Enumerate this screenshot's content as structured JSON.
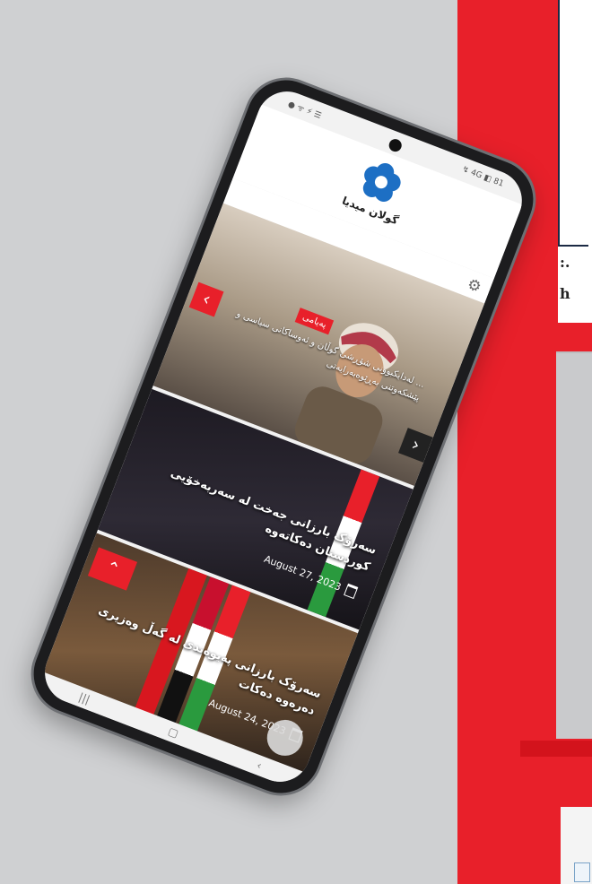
{
  "background": {
    "accent_red": "#e8202a",
    "side_text_1": ":.",
    "side_text_2": "h"
  },
  "status_bar": {
    "left_icons": "● ᯤ ⚡ ☰",
    "right_icons": "↯ 4G ◧ 81"
  },
  "app": {
    "brand_name": "گولان میدیا",
    "logo_icon": "flower-logo-icon",
    "settings_icon": "gear-icon"
  },
  "slider": {
    "category": "پەیامی",
    "title": "... لەدایکبوونی شۆڕشی گوڵان و ئەوساکانی سیاسی و پێشکەوتنی بەڕێوەبەرایەتی",
    "prev_icon": "chevron-left-icon",
    "next_icon": "chevron-right-icon"
  },
  "articles": [
    {
      "title": "سەرۆک بارزانی جەخت لە سەربەخۆیی کوردستان دەکاتەوە",
      "date": "August 27, 2023"
    },
    {
      "title": "سەرۆک بارزانی پەیوەندی لە گەڵ وەزیری دەرەوە دەکات",
      "date": "August 24, 2023"
    }
  ],
  "bottom_nav": {
    "recent_icon": "|||",
    "home_icon": "▢",
    "back_icon": "‹"
  }
}
